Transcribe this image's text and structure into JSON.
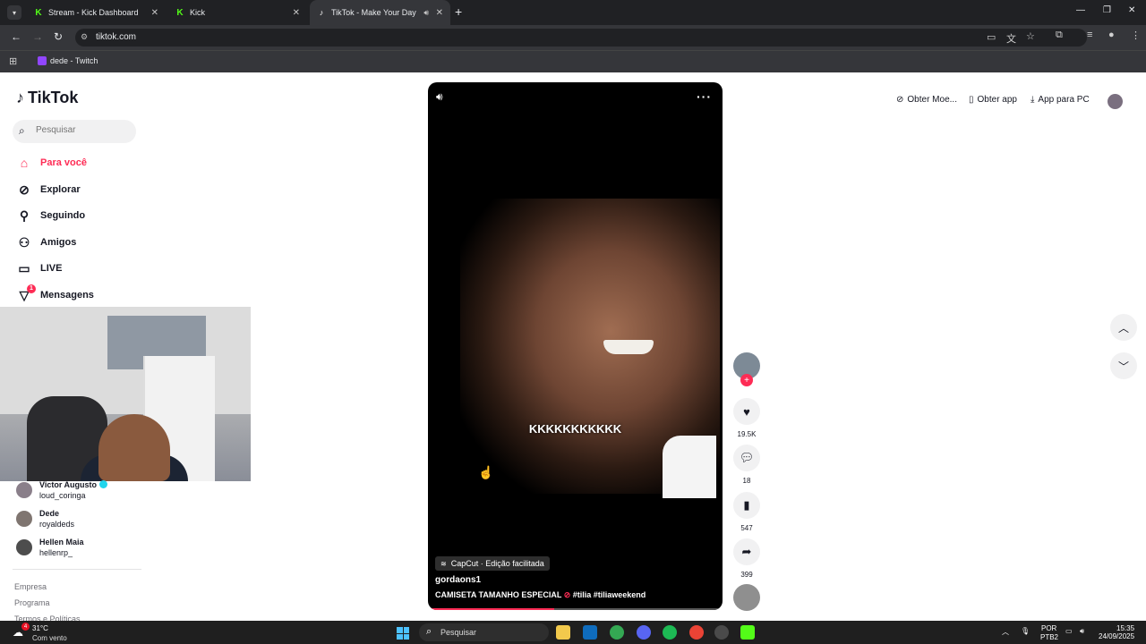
{
  "browser": {
    "tabs": [
      {
        "title": "Stream - Kick Dashboard",
        "active": false
      },
      {
        "title": "Kick",
        "active": false
      },
      {
        "title": "TikTok - Make Your Day",
        "active": true
      }
    ],
    "url": "tiktok.com",
    "bookmarks": [
      {
        "label": "dede - Twitch"
      }
    ]
  },
  "sidebar": {
    "logo": "TikTok",
    "search_placeholder": "Pesquisar",
    "nav": [
      {
        "label": "Para você",
        "icon": "home-icon",
        "active": true
      },
      {
        "label": "Explorar",
        "icon": "compass-icon"
      },
      {
        "label": "Seguindo",
        "icon": "following-icon"
      },
      {
        "label": "Amigos",
        "icon": "friends-icon"
      },
      {
        "label": "LIVE",
        "icon": "live-icon"
      },
      {
        "label": "Mensagens",
        "icon": "messages-icon",
        "badge": "1"
      }
    ],
    "following": [
      {
        "name": "Victor Augusto",
        "handle": "loud_coringa",
        "verified": true
      },
      {
        "name": "Dede",
        "handle": "royaldeds"
      },
      {
        "name": "Hellen Maia",
        "handle": "hellenrp_"
      }
    ],
    "footer_links": [
      "Empresa",
      "Programa",
      "Termos e Políticas"
    ]
  },
  "video": {
    "overlay_text": "KKKKKKKKKKK",
    "capcut_label": "CapCut · Edição facilitada",
    "author": "gordaons1",
    "description": "CAMISETA TAMANHO ESPECIAL",
    "hashtags": [
      "#tilia",
      "#tiliaweekend"
    ],
    "progress": 0.43
  },
  "actions": {
    "likes": "19.5K",
    "comments": "18",
    "saves": "547",
    "shares": "399"
  },
  "header": {
    "buttons": [
      "Obter Moe...",
      "Obter app",
      "App para PC"
    ]
  },
  "taskbar": {
    "temperature": "31°C",
    "weather": "Com vento",
    "search_placeholder": "Pesquisar",
    "lang": "POR",
    "layout": "PTB2",
    "time": "15:35",
    "date": "24/09/2025",
    "weather_badge": "4"
  },
  "colors": {
    "accent": "#fe2c55",
    "kick": "#53fc18"
  }
}
